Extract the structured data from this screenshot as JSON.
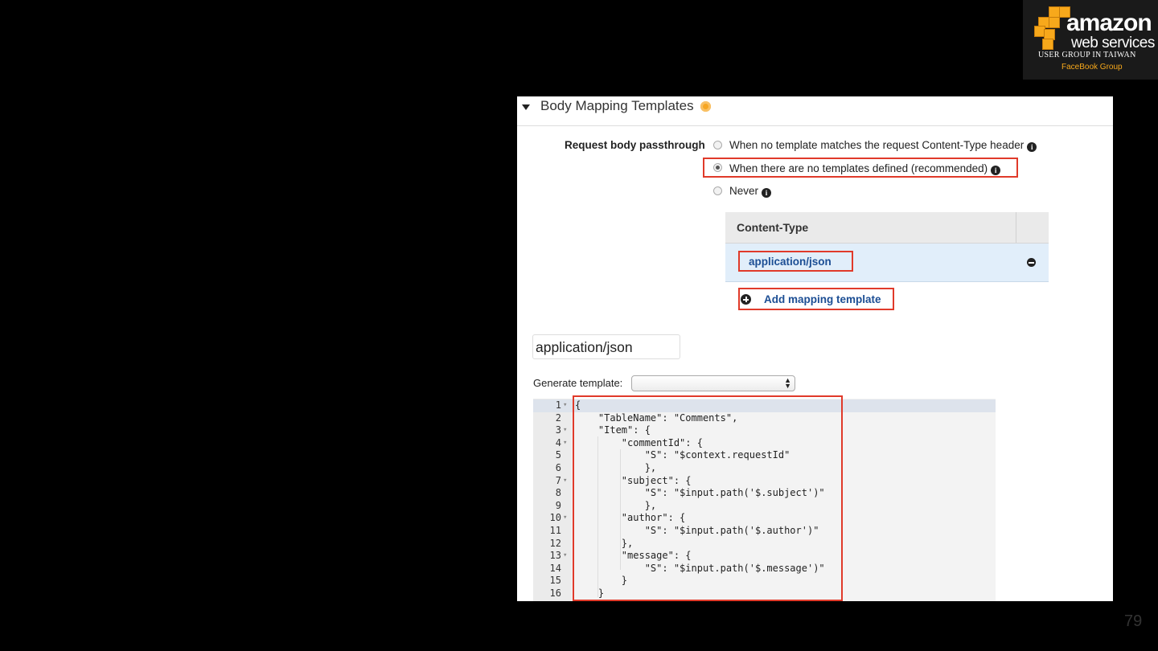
{
  "logo": {
    "line1": "amazon",
    "line2": "web services",
    "line3": "USER GROUP IN TAIWAN",
    "line4": "FaceBook Group"
  },
  "page_number": "79",
  "section": {
    "title": "Body Mapping Templates",
    "passthrough_label": "Request body passthrough",
    "options": [
      {
        "label": "When no template matches the request Content-Type header",
        "selected": false
      },
      {
        "label": "When there are no templates defined (recommended)",
        "selected": true
      },
      {
        "label": "Never",
        "selected": false
      }
    ],
    "info_glyph": "i",
    "content_type_header": "Content-Type",
    "content_types": [
      "application/json"
    ],
    "add_mapping_label": "Add mapping template",
    "template_content_type": "application/json",
    "generate_label": "Generate template:",
    "generate_value": ""
  },
  "editor": {
    "lines": [
      {
        "n": "1",
        "fold": true,
        "code": "{"
      },
      {
        "n": "2",
        "fold": false,
        "code": "    \"TableName\": \"Comments\","
      },
      {
        "n": "3",
        "fold": true,
        "code": "    \"Item\": {"
      },
      {
        "n": "4",
        "fold": true,
        "code": "        \"commentId\": {"
      },
      {
        "n": "5",
        "fold": false,
        "code": "            \"S\": \"$context.requestId\""
      },
      {
        "n": "6",
        "fold": false,
        "code": "            },"
      },
      {
        "n": "7",
        "fold": true,
        "code": "        \"subject\": {"
      },
      {
        "n": "8",
        "fold": false,
        "code": "            \"S\": \"$input.path('$.subject')\""
      },
      {
        "n": "9",
        "fold": false,
        "code": "            },"
      },
      {
        "n": "10",
        "fold": true,
        "code": "        \"author\": {"
      },
      {
        "n": "11",
        "fold": false,
        "code": "            \"S\": \"$input.path('$.author')\""
      },
      {
        "n": "12",
        "fold": false,
        "code": "        },"
      },
      {
        "n": "13",
        "fold": true,
        "code": "        \"message\": {"
      },
      {
        "n": "14",
        "fold": false,
        "code": "            \"S\": \"$input.path('$.message')\""
      },
      {
        "n": "15",
        "fold": false,
        "code": "        }"
      },
      {
        "n": "16",
        "fold": false,
        "code": "    }"
      }
    ]
  },
  "colors": {
    "highlight_box": "#e03a2a",
    "link": "#1c4e94",
    "row_selected": "#e1eefa",
    "help_icon": "#f6a623",
    "logo_accent": "#f7a81b"
  }
}
